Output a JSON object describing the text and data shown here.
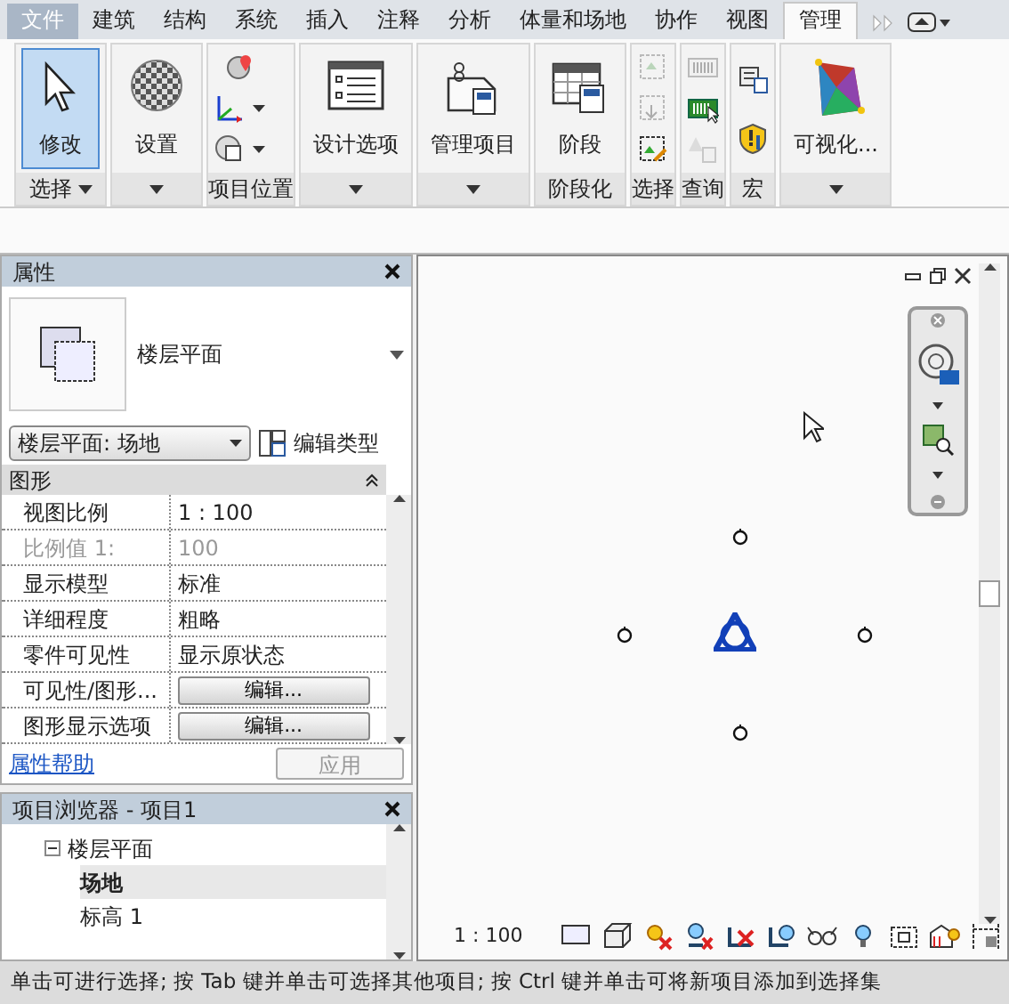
{
  "tabs": [
    {
      "label": "文件",
      "kind": "file",
      "selected": false
    },
    {
      "label": "建筑",
      "kind": "tab",
      "selected": false
    },
    {
      "label": "结构",
      "kind": "tab",
      "selected": false
    },
    {
      "label": "系统",
      "kind": "tab",
      "selected": false
    },
    {
      "label": "插入",
      "kind": "tab",
      "selected": false
    },
    {
      "label": "注释",
      "kind": "tab",
      "selected": false
    },
    {
      "label": "分析",
      "kind": "tab",
      "selected": false
    },
    {
      "label": "体量和场地",
      "kind": "tab",
      "selected": false
    },
    {
      "label": "协作",
      "kind": "tab",
      "selected": false
    },
    {
      "label": "视图",
      "kind": "tab",
      "selected": false
    },
    {
      "label": "管理",
      "kind": "tab",
      "selected": true
    }
  ],
  "ribbon": [
    {
      "title": "选择",
      "menu": true,
      "tools": [
        {
          "kind": "large",
          "label": "修改",
          "selected": true
        }
      ]
    },
    {
      "menu": true,
      "tools": [
        {
          "kind": "large",
          "label": "设置",
          "selected": false
        }
      ]
    },
    {
      "title": "项目位置",
      "menu": false,
      "tools": [
        {
          "kind": "small",
          "disabled": false
        },
        {
          "kind": "small",
          "disabled": false
        },
        {
          "kind": "small",
          "disabled": false
        }
      ]
    },
    {
      "menu": true,
      "tools": [
        {
          "kind": "large",
          "label": "设计选项",
          "selected": false
        }
      ]
    },
    {
      "menu": true,
      "tools": [
        {
          "kind": "large",
          "label": "管理项目",
          "selected": false
        }
      ]
    },
    {
      "title": "阶段化",
      "menu": false,
      "tools": [
        {
          "kind": "large",
          "label": "阶段",
          "selected": false
        }
      ]
    },
    {
      "title": "选择",
      "menu": false,
      "tools": [
        {
          "kind": "small",
          "disabled": true
        },
        {
          "kind": "small",
          "disabled": true
        },
        {
          "kind": "small",
          "disabled": false
        }
      ]
    },
    {
      "title": "查询",
      "menu": false,
      "tools": [
        {
          "kind": "small",
          "disabled": true
        },
        {
          "kind": "small",
          "disabled": false
        },
        {
          "kind": "small",
          "disabled": true
        }
      ]
    },
    {
      "title": "宏",
      "menu": false,
      "tools": [
        {
          "kind": "small",
          "disabled": false
        },
        {
          "kind": "small",
          "disabled": false
        }
      ]
    },
    {
      "menu": true,
      "tools": [
        {
          "kind": "large",
          "label": "可视化...",
          "selected": false
        }
      ]
    }
  ],
  "properties": {
    "title": "属性",
    "type_name": "楼层平面",
    "selector": "楼层平面: 场地",
    "edit_type": "编辑类型",
    "group": "图形",
    "rows": [
      {
        "label": "视图比例",
        "value": "1 : 100",
        "kind": "text",
        "disabled": false
      },
      {
        "label": "比例值 1:",
        "value": "100",
        "kind": "text",
        "disabled": true
      },
      {
        "label": "显示模型",
        "value": "标准",
        "kind": "text",
        "disabled": false
      },
      {
        "label": "详细程度",
        "value": "粗略",
        "kind": "text",
        "disabled": false
      },
      {
        "label": "零件可见性",
        "value": "显示原状态",
        "kind": "text",
        "disabled": false
      },
      {
        "label": "可见性/图形...",
        "value": "编辑...",
        "kind": "button",
        "disabled": false
      },
      {
        "label": "图形显示选项",
        "value": "编辑...",
        "kind": "button",
        "disabled": false
      }
    ],
    "help": "属性帮助",
    "apply": "应用"
  },
  "browser": {
    "title": "项目浏览器 - 项目1",
    "tree": [
      {
        "label": "楼层平面",
        "expanded": true,
        "selected": false,
        "children": [
          {
            "label": "场地",
            "selected": true
          },
          {
            "label": "标高 1",
            "selected": false
          }
        ]
      }
    ]
  },
  "view": {
    "scale": "1 : 100"
  },
  "status_bar": "单击可进行选择; 按 Tab 键并单击可选择其他项目; 按 Ctrl 键并单击可将新项目添加到选择集"
}
